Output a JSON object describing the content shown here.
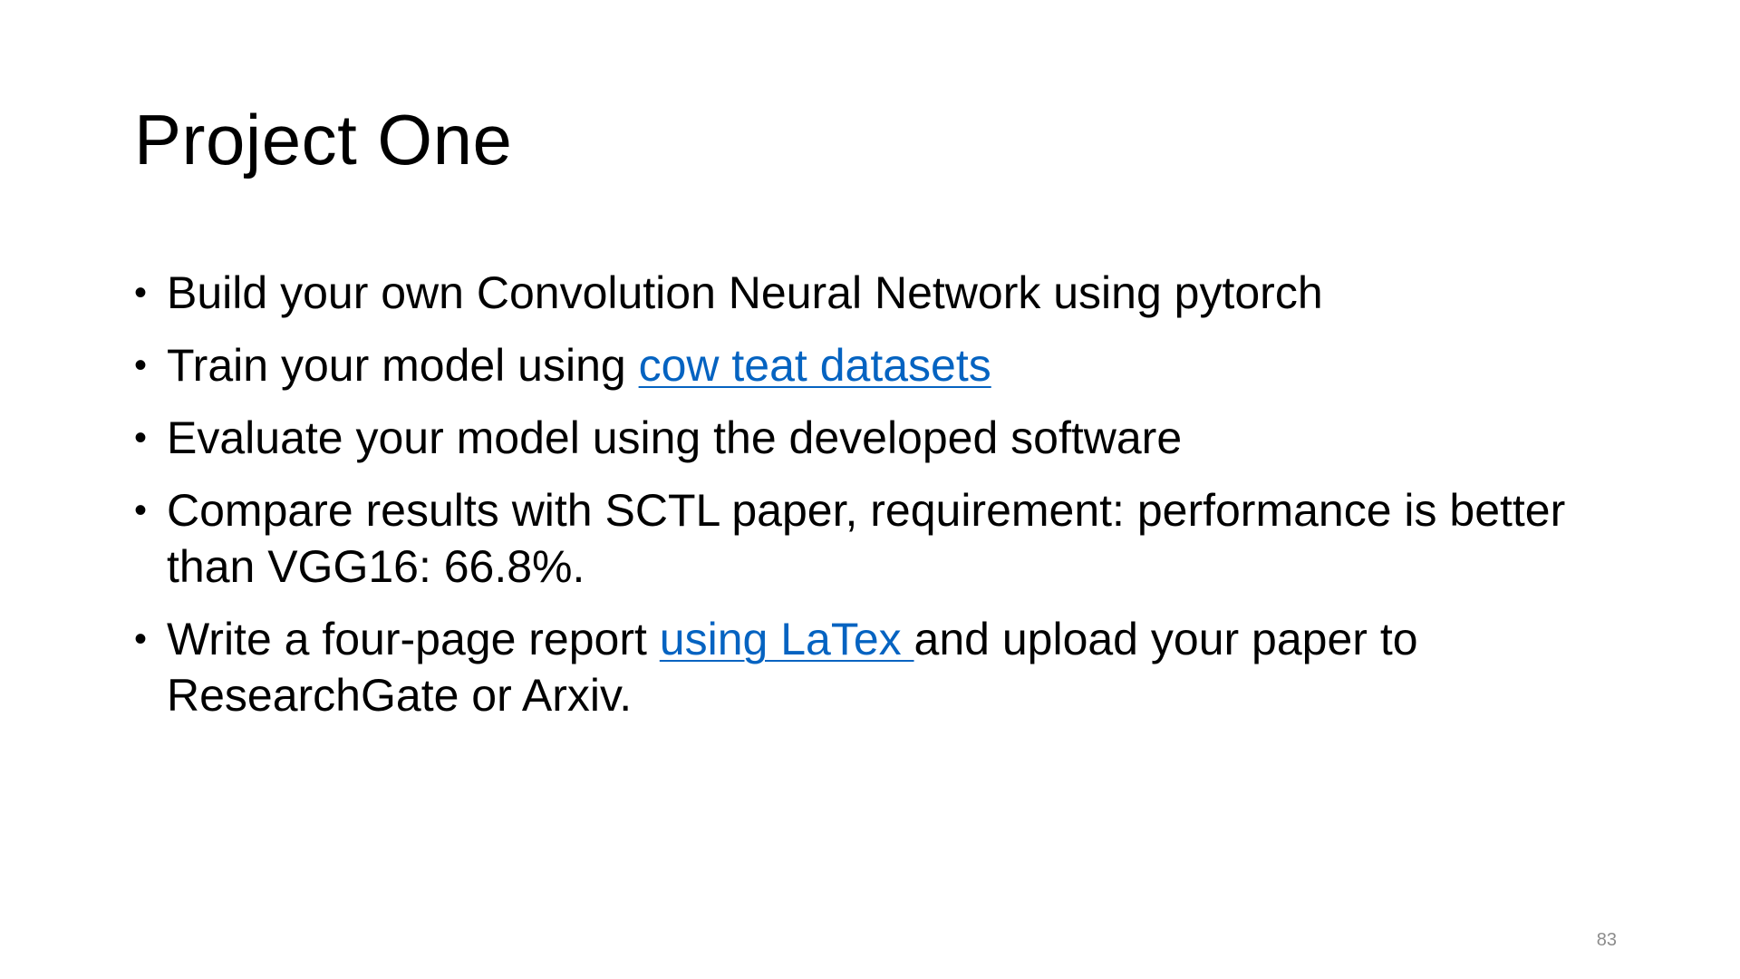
{
  "slide": {
    "title": "Project One",
    "page_number": "83",
    "link_color": "#0563c1",
    "bullets": [
      {
        "text": "Build your own Convolution Neural Network using pytorch"
      },
      {
        "before": "Train your model using ",
        "link": "cow teat datasets"
      },
      {
        "text": "Evaluate your model using the developed software"
      },
      {
        "text": "Compare results with SCTL paper, requirement: performance is better than VGG16: 66.8%."
      },
      {
        "before": "Write a four-page report ",
        "link": "using LaTex ",
        "after": "and upload your paper to ResearchGate or Arxiv."
      }
    ]
  }
}
